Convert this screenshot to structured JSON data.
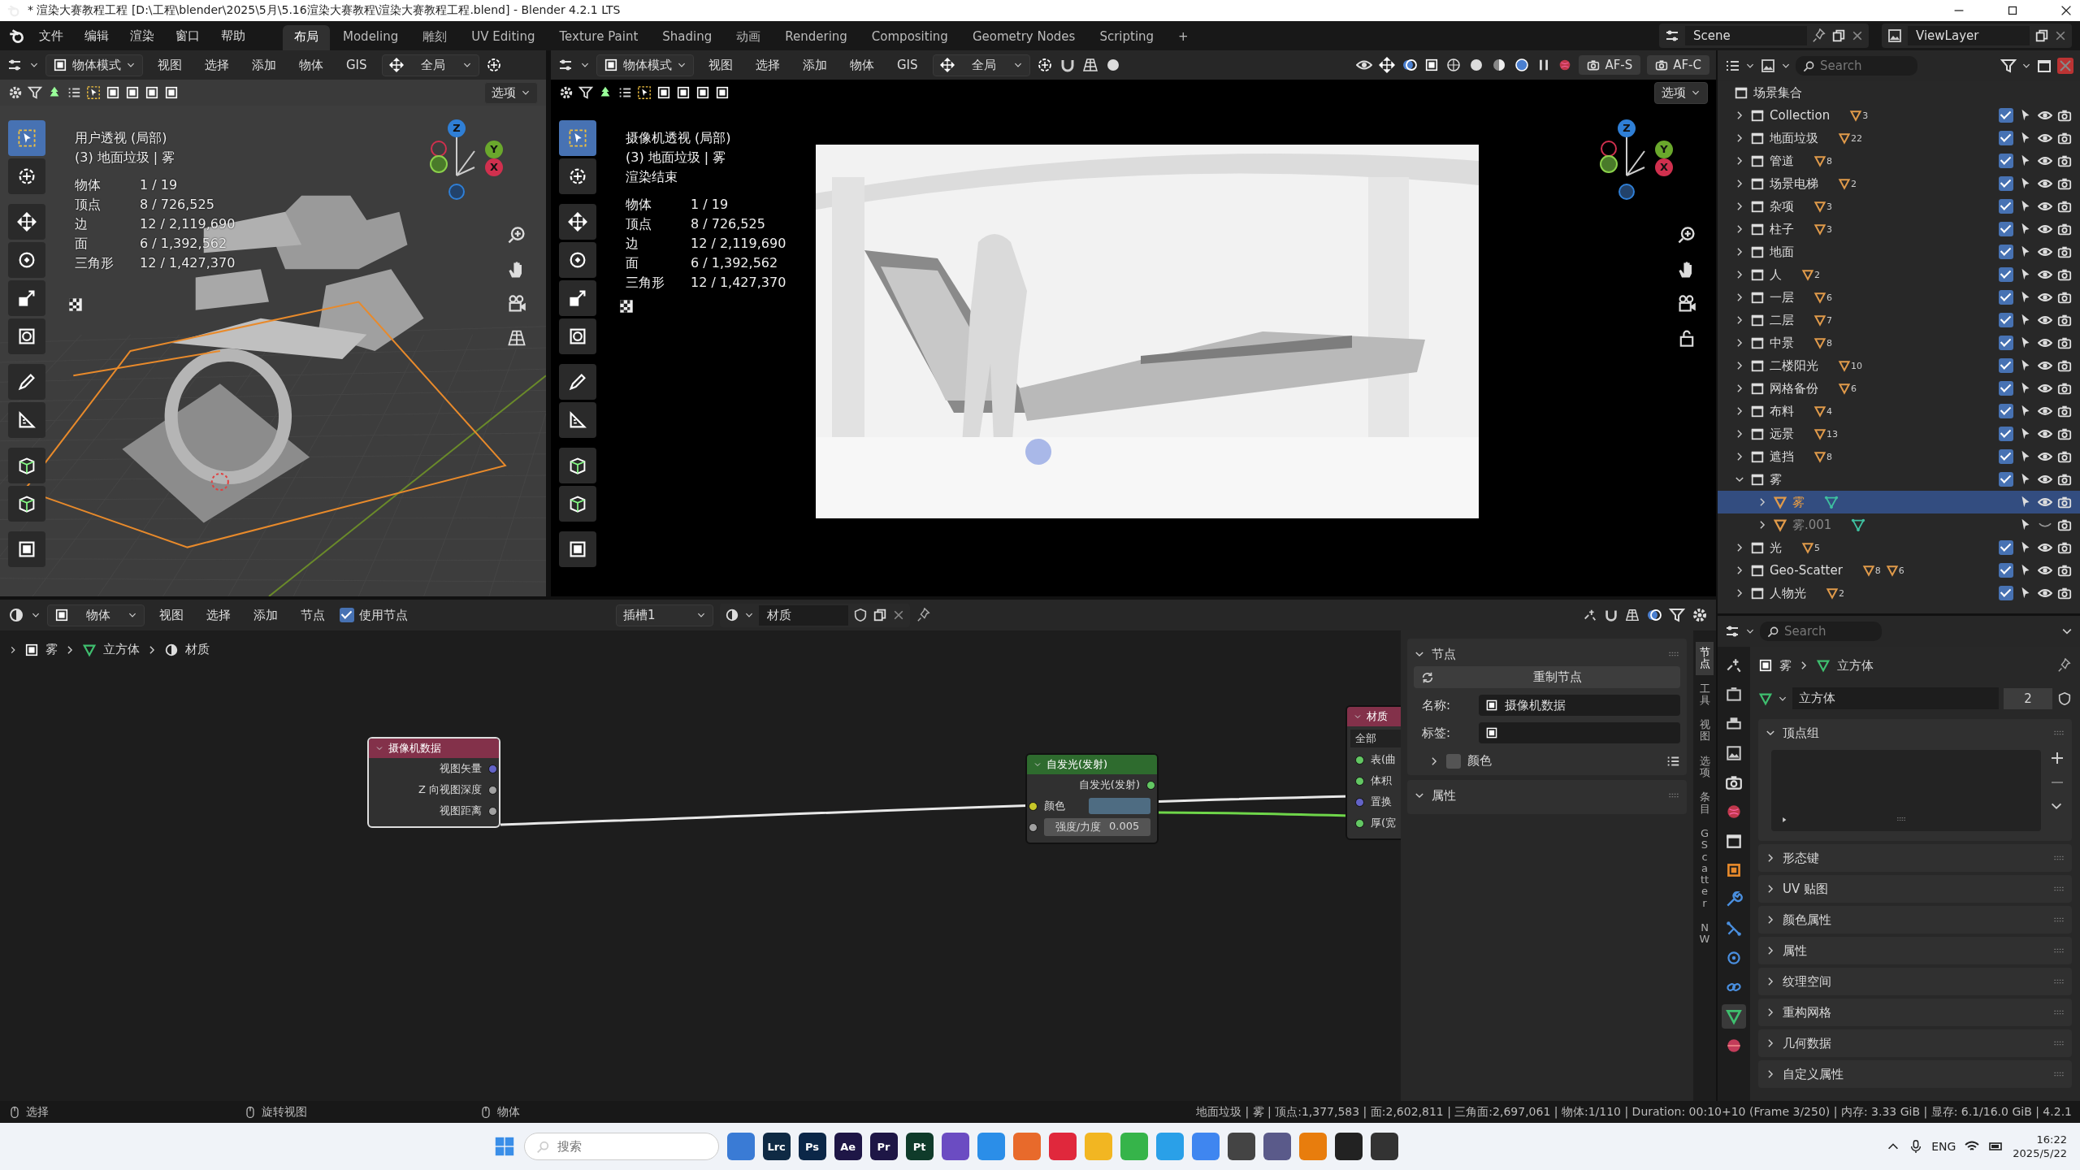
{
  "title_bar": {
    "title": "* 渲染大赛教程工程 [D:\\工程\\blender\\2025\\5月\\5.16渲染大赛教程\\渲染大赛教程工程.blend] - Blender 4.2.1 LTS"
  },
  "menu": [
    "文件",
    "编辑",
    "渲染",
    "窗口",
    "帮助"
  ],
  "workspaces": [
    {
      "label": "布局",
      "selected": true
    },
    {
      "label": "Modeling",
      "selected": false
    },
    {
      "label": "雕刻",
      "selected": false
    },
    {
      "label": "UV Editing",
      "selected": false
    },
    {
      "label": "Texture Paint",
      "selected": false
    },
    {
      "label": "Shading",
      "selected": false
    },
    {
      "label": "动画",
      "selected": false
    },
    {
      "label": "Rendering",
      "selected": false
    },
    {
      "label": "Compositing",
      "selected": false
    },
    {
      "label": "Geometry Nodes",
      "selected": false
    },
    {
      "label": "Scripting",
      "selected": false
    }
  ],
  "add_workspace": "+",
  "scene": "Scene",
  "view_layer": "ViewLayer",
  "viewports": [
    {
      "kind": "solid",
      "mode": "物体模式",
      "menus": [
        "视图",
        "选择",
        "添加",
        "物体",
        "GIS"
      ],
      "orientation": "全局",
      "options": "选项",
      "overlay": [
        "用户透视 (局部)",
        "(3) 地面垃圾 | 雾"
      ],
      "stats": [
        {
          "label": "物体",
          "value": "1 / 19"
        },
        {
          "label": "顶点",
          "value": "8 / 726,525"
        },
        {
          "label": "边",
          "value": "12 / 2,119,690"
        },
        {
          "label": "面",
          "value": "6 / 1,392,562"
        },
        {
          "label": "三角形",
          "value": "12 / 1,427,370"
        }
      ],
      "axes": [
        "Z",
        "Y",
        "X"
      ]
    },
    {
      "kind": "camera",
      "mode": "物体模式",
      "menus": [
        "视图",
        "选择",
        "添加",
        "物体",
        "GIS"
      ],
      "orientation": "全局",
      "focus": [
        "AF-S",
        "AF-C"
      ],
      "options": "选项",
      "overlay": [
        "摄像机透视 (局部)",
        "(3) 地面垃圾 | 雾",
        "渲染结束"
      ],
      "stats": [
        {
          "label": "物体",
          "value": "1 / 19"
        },
        {
          "label": "顶点",
          "value": "8 / 726,525"
        },
        {
          "label": "边",
          "value": "12 / 2,119,690"
        },
        {
          "label": "面",
          "value": "6 / 1,392,562"
        },
        {
          "label": "三角形",
          "value": "12 / 1,427,370"
        }
      ],
      "axes": [
        "Z",
        "Y",
        "X"
      ]
    }
  ],
  "outliner": {
    "search_placeholder": "Search",
    "root": "场景集合",
    "items": [
      {
        "name": "Collection",
        "counts": [
          "3"
        ],
        "checked": true,
        "expanded": false,
        "selected": false
      },
      {
        "name": "地面垃圾",
        "counts": [
          "22"
        ],
        "checked": true,
        "expanded": false,
        "selected": false
      },
      {
        "name": "管道",
        "counts": [
          "8"
        ],
        "checked": true,
        "expanded": false,
        "selected": false
      },
      {
        "name": "场景电梯",
        "counts": [
          "2"
        ],
        "checked": true,
        "expanded": false,
        "selected": false
      },
      {
        "name": "杂项",
        "counts": [
          "3"
        ],
        "checked": true,
        "expanded": false,
        "selected": false
      },
      {
        "name": "柱子",
        "counts": [
          "3"
        ],
        "checked": true,
        "expanded": false,
        "selected": false
      },
      {
        "name": "地面",
        "checked": true,
        "expanded": false,
        "selected": false
      },
      {
        "name": "人",
        "counts": [
          "2"
        ],
        "checked": true,
        "expanded": false,
        "selected": false
      },
      {
        "name": "一层",
        "counts": [
          "6"
        ],
        "checked": true,
        "expanded": false,
        "selected": false
      },
      {
        "name": "二层",
        "counts": [
          "7"
        ],
        "checked": true,
        "expanded": false,
        "selected": false
      },
      {
        "name": "中景",
        "counts": [
          "8"
        ],
        "checked": true,
        "expanded": false,
        "selected": false
      },
      {
        "name": "二楼阳光",
        "counts": [
          "10"
        ],
        "checked": true,
        "expanded": false,
        "selected": false
      },
      {
        "name": "网格备份",
        "counts": [
          "6"
        ],
        "checked": true,
        "expanded": false,
        "selected": false
      },
      {
        "name": "布料",
        "counts": [
          "4"
        ],
        "checked": true,
        "expanded": false,
        "selected": false
      },
      {
        "name": "远景",
        "counts": [
          "13"
        ],
        "checked": true,
        "expanded": false,
        "selected": false
      },
      {
        "name": "遮挡",
        "counts": [
          "8"
        ],
        "checked": true,
        "expanded": false,
        "selected": false
      },
      {
        "name": "雾",
        "checked": true,
        "expanded": true,
        "selected": false,
        "children": [
          {
            "name": "雾",
            "selected": true,
            "visible": true
          },
          {
            "name": "雾.001",
            "selected": false,
            "visible": false
          }
        ]
      },
      {
        "name": "光",
        "counts": [
          "5"
        ],
        "checked": true,
        "expanded": false,
        "selected": false
      },
      {
        "name": "Geo-Scatter",
        "counts": [
          "8",
          "6"
        ],
        "checked": true,
        "expanded": false,
        "selected": false
      },
      {
        "name": "人物光",
        "counts": [
          "2"
        ],
        "checked": true,
        "expanded": false,
        "selected": false
      }
    ]
  },
  "properties": {
    "search_placeholder": "Search",
    "breadcrumb": [
      "雾",
      "立方体"
    ],
    "datablock": "立方体",
    "users": "2",
    "panels": [
      {
        "label": "顶点组",
        "expanded": true
      },
      {
        "label": "形态键",
        "expanded": false
      },
      {
        "label": "UV 贴图",
        "expanded": false
      },
      {
        "label": "颜色属性",
        "expanded": false
      },
      {
        "label": "属性",
        "expanded": false
      },
      {
        "label": "纹理空间",
        "expanded": false
      },
      {
        "label": "重构网格",
        "expanded": false
      },
      {
        "label": "几何数据",
        "expanded": false
      },
      {
        "label": "自定义属性",
        "expanded": false
      }
    ]
  },
  "node_editor": {
    "type": "物体",
    "menus": [
      "视图",
      "选择",
      "添加",
      "节点"
    ],
    "use_nodes": {
      "label": "使用节点",
      "checked": true
    },
    "slot": "插槽1",
    "material": "材质",
    "breadcrumb": [
      "雾",
      "立方体",
      "材质"
    ],
    "nodes": [
      {
        "kind": "input",
        "title": "摄像机数据",
        "color": "#83314a",
        "outputs": [
          "视图矢量",
          "Z 向视图深度",
          "视图距离"
        ]
      },
      {
        "kind": "shader",
        "title": "自发光(发射)",
        "color": "#2e6b2e",
        "outputs": [
          "自发光(发射)"
        ],
        "inputs": [
          {
            "kind": "color",
            "label": "颜色",
            "color": "#4e6c82"
          },
          {
            "kind": "value",
            "label": "强度/力度",
            "value": "0.005"
          }
        ]
      },
      {
        "kind": "output",
        "title": "材质",
        "color": "#83314a",
        "target": "全部",
        "inputs": [
          "表(曲",
          "体积",
          "置换",
          "厚(宽"
        ]
      }
    ],
    "sidebar": {
      "sections": [
        {
          "label": "节点",
          "expanded": true,
          "button": "重制节点",
          "fields": [
            {
              "label": "名称:",
              "value": "摄像机数据"
            },
            {
              "label": "标签:"
            }
          ],
          "sub": {
            "label": "颜色",
            "checked": false,
            "expanded": false
          }
        },
        {
          "label": "属性",
          "expanded": true
        }
      ],
      "tabs": [
        {
          "label": "节点",
          "selected": true
        },
        {
          "label": "工具",
          "selected": false
        },
        {
          "label": "视图",
          "selected": false
        },
        {
          "label": "选项",
          "selected": false
        },
        {
          "label": "条目",
          "selected": false
        },
        {
          "label": "GScatter",
          "selected": false
        },
        {
          "label": "NW",
          "selected": false
        }
      ]
    }
  },
  "status_bar": {
    "hints": [
      "选择",
      "旋转视图",
      "物体"
    ],
    "info": "地面垃圾 | 雾 | 顶点:1,377,583 | 面:2,602,811 | 三角面:2,697,061 | 物体:1/110 | Duration: 00:10+10 (Frame 3/250) | 内存: 3.33 GiB | 显存: 6.1/16.0 GiB | 4.2.1"
  },
  "taskbar": {
    "search_placeholder": "搜索",
    "apps": [
      {
        "color": "#3a7bd5"
      },
      {
        "label": "Lrc",
        "color": "#0f2a44"
      },
      {
        "label": "Ps",
        "color": "#0b2748"
      },
      {
        "label": "Ae",
        "color": "#1e1646"
      },
      {
        "label": "Pr",
        "color": "#1e1646"
      },
      {
        "label": "Pt",
        "color": "#0f3b2a"
      },
      {
        "color": "#6b4cc2"
      },
      {
        "color": "#2b8ee8"
      },
      {
        "color": "#e86a2b"
      },
      {
        "color": "#e0283c"
      },
      {
        "color": "#f2b622"
      },
      {
        "color": "#36b44a"
      },
      {
        "color": "#2aa0e8"
      },
      {
        "color": "#3f86f0"
      },
      {
        "color": "#444444"
      },
      {
        "color": "#5a5a8a"
      },
      {
        "color": "#e87d0d"
      },
      {
        "color": "#222222"
      },
      {
        "color": "#333333"
      }
    ],
    "language": "ENG",
    "time": "16:22",
    "date": "2025/5/22"
  }
}
